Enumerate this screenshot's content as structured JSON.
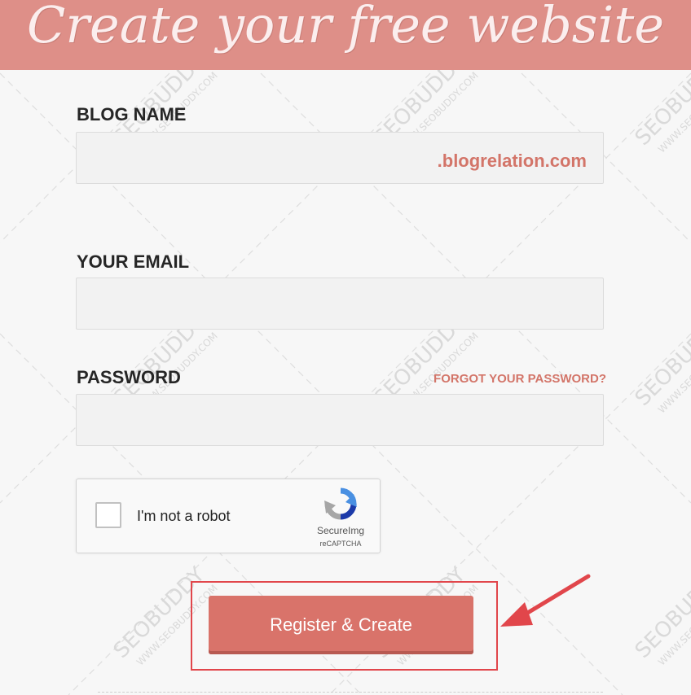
{
  "banner": {
    "title": "Create your free website",
    "background": "#de8f88"
  },
  "form": {
    "blog_name": {
      "label": "BLOG NAME",
      "value": "",
      "suffix": ".blogrelation.com"
    },
    "email": {
      "label": "YOUR EMAIL",
      "value": ""
    },
    "password": {
      "label": "PASSWORD",
      "value": "",
      "forgot_link": "FORGOT YOUR PASSWORD?"
    },
    "captcha": {
      "checkbox_label": "I'm not a robot",
      "checked": false,
      "brand": "SecureImg",
      "sub": "reCAPTCHA",
      "icon": "recaptcha-icon"
    },
    "submit_label": "Register & Create"
  },
  "annotation": {
    "highlight_color": "#e1464b",
    "arrow_icon": "red-arrow-icon"
  },
  "watermark": {
    "brand": "SEOBUDDY",
    "url": "WWW.SEOBUDDY.COM"
  },
  "colors": {
    "accent": "#d37569",
    "button": "#d9736a",
    "page_bg": "#f7f7f7"
  }
}
